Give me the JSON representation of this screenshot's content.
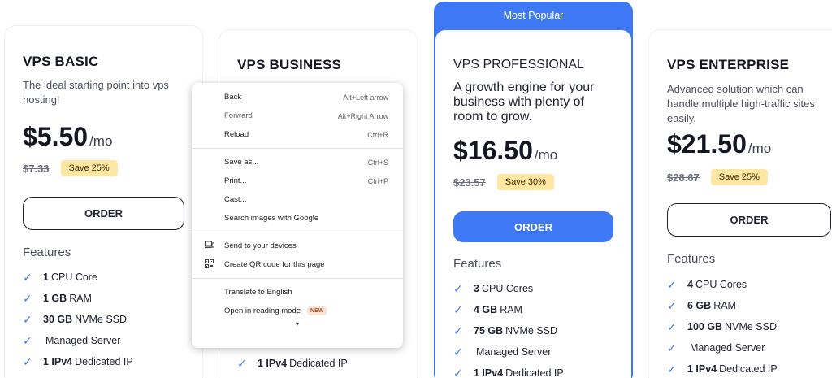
{
  "plans": [
    {
      "title": "VPS BASIC",
      "desc": "The ideal starting point into vps hosting!",
      "price": "$5.50",
      "per": "/mo",
      "old_price": "$7.33",
      "save": "Save 25%",
      "order": "ORDER",
      "features_heading": "Features",
      "features": [
        {
          "bold": "1",
          "text": "CPU Core"
        },
        {
          "bold": "1 GB",
          "text": "RAM"
        },
        {
          "bold": "30 GB",
          "text": "NVMe SSD"
        },
        {
          "bold": "",
          "text": "Managed Server"
        },
        {
          "bold": "1 IPv4",
          "text": "Dedicated IP"
        }
      ]
    },
    {
      "title": "VPS BUSINESS",
      "features": [
        {
          "bold": "1 IPv4",
          "text": "Dedicated IP"
        }
      ]
    },
    {
      "badge": "Most Popular",
      "title": "VPS PROFESSIONAL",
      "desc": "A growth engine for your business with plenty of room to grow.",
      "price": "$16.50",
      "per": "/mo",
      "old_price": "$23.57",
      "save": "Save 30%",
      "order": "ORDER",
      "features_heading": "Features",
      "features": [
        {
          "bold": "3",
          "text": "CPU Cores"
        },
        {
          "bold": "4 GB",
          "text": "RAM"
        },
        {
          "bold": "75 GB",
          "text": "NVMe SSD"
        },
        {
          "bold": "",
          "text": "Managed Server"
        },
        {
          "bold": "1 IPv4",
          "text": "Dedicated IP"
        }
      ]
    },
    {
      "title": "VPS ENTERPRISE",
      "desc": "Advanced solution which can handle multiple high-traffic sites easily.",
      "price": "$21.50",
      "per": "/mo",
      "old_price": "$28.67",
      "save": "Save 25%",
      "order": "ORDER",
      "features_heading": "Features",
      "features": [
        {
          "bold": "4",
          "text": "CPU Cores"
        },
        {
          "bold": "6 GB",
          "text": "RAM"
        },
        {
          "bold": "100 GB",
          "text": "NVMe SSD"
        },
        {
          "bold": "",
          "text": "Managed Server"
        },
        {
          "bold": "1 IPv4",
          "text": "Dedicated IP"
        }
      ]
    }
  ],
  "context_menu": {
    "back": {
      "label": "Back",
      "shortcut": "Alt+Left arrow"
    },
    "forward": {
      "label": "Forward",
      "shortcut": "Alt+Right Arrow"
    },
    "reload": {
      "label": "Reload",
      "shortcut": "Ctrl+R"
    },
    "save_as": {
      "label": "Save as...",
      "shortcut": "Ctrl+S"
    },
    "print": {
      "label": "Print...",
      "shortcut": "Ctrl+P"
    },
    "cast": {
      "label": "Cast..."
    },
    "search_images": {
      "label": "Search images with Google"
    },
    "send_devices": {
      "label": "Send to your devices",
      "icon": "devices-icon"
    },
    "qr_code": {
      "label": "Create QR code for this page",
      "icon": "qr-code-icon"
    },
    "translate": {
      "label": "Translate to English"
    },
    "reading_mode": {
      "label": "Open in reading mode",
      "badge": "NEW"
    }
  },
  "colors": {
    "accent": "#3f78f5",
    "save_badge": "#ffe6a3",
    "text": "#1f2230"
  }
}
